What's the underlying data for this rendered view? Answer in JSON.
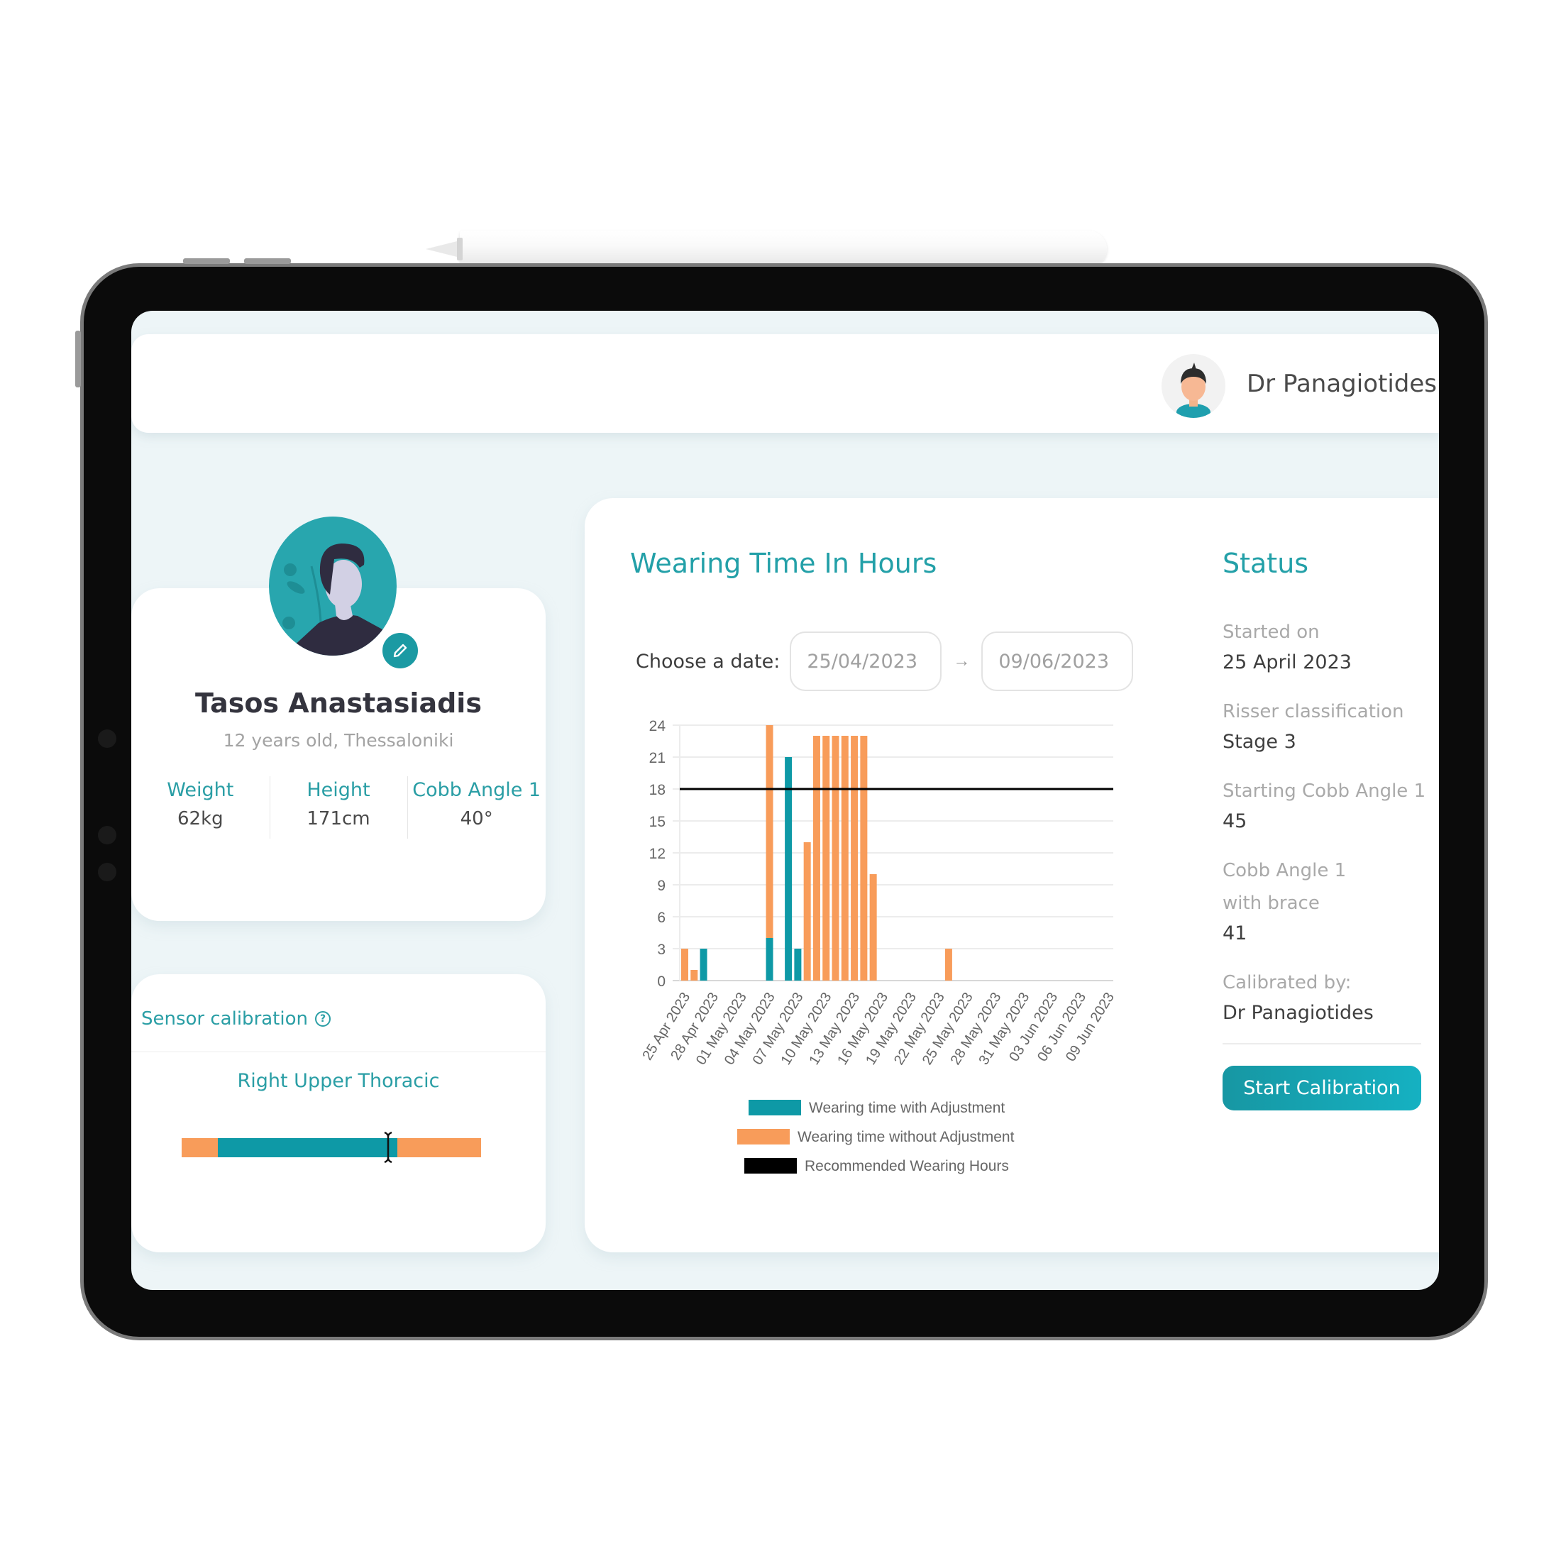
{
  "header": {
    "user_name": "Dr Panagiotides",
    "avatar_icon": "doctor-avatar-icon"
  },
  "profile": {
    "name": "Tasos Anastasiadis",
    "subtitle": "12 years old, Thessaloniki",
    "metrics": [
      {
        "label": "Weight",
        "value": "62kg"
      },
      {
        "label": "Height",
        "value": "171cm"
      },
      {
        "label": "Cobb Angle 1",
        "value": "40°"
      }
    ],
    "edit_icon": "pencil-icon"
  },
  "sensor": {
    "title": "Sensor calibration",
    "help_icon": "?",
    "region": "Right Upper Thoracic",
    "range_fraction": [
      0.12,
      0.72
    ],
    "cursor_fraction": 0.69,
    "colors": {
      "range": "#0e99a6",
      "outside": "#f89c5a"
    }
  },
  "wearing": {
    "title": "Wearing Time In Hours",
    "date_label": "Choose a date:",
    "date_from": "25/04/2023",
    "date_to": "09/06/2023",
    "arrow": "→"
  },
  "status": {
    "title": "Status",
    "items": [
      {
        "label": "Started on",
        "value": "25 April 2023"
      },
      {
        "label": "Risser classification",
        "value": "Stage 3"
      },
      {
        "label": "Starting Cobb Angle 1",
        "value": "45"
      },
      {
        "label": "Cobb Angle 1 with brace",
        "value": "41"
      },
      {
        "label": "Calibrated by:",
        "value": "Dr Panagiotides"
      }
    ],
    "button_label": "Start Calibration"
  },
  "chart_data": {
    "type": "bar",
    "stacked": true,
    "title": "Wearing Time In Hours",
    "xlabel": "",
    "ylabel": "",
    "ylim": [
      0,
      24
    ],
    "yticks": [
      0,
      3,
      6,
      9,
      12,
      15,
      18,
      21,
      24
    ],
    "grid": true,
    "legend_position": "bottom",
    "start_date": "2023-04-25",
    "num_days": 46,
    "tick_labels": [
      "25 Apr 2023",
      "28 Apr 2023",
      "01 May 2023",
      "04 May 2023",
      "07 May 2023",
      "10 May 2023",
      "13 May 2023",
      "16 May 2023",
      "19 May 2023",
      "22 May 2023",
      "25 May 2023",
      "28 May 2023",
      "31 May 2023",
      "03 Jun 2023",
      "06 Jun 2023",
      "09 Jun 2023"
    ],
    "tick_every_days": 3,
    "series": [
      {
        "name": "Wearing time with Adjustment",
        "color": "#0e99a6",
        "points": [
          {
            "date": "27 Apr 2023",
            "value": 3
          },
          {
            "date": "04 May 2023",
            "value": 4
          },
          {
            "date": "06 May 2023",
            "value": 21
          },
          {
            "date": "07 May 2023",
            "value": 3
          }
        ]
      },
      {
        "name": "Wearing time without Adjustment",
        "color": "#f89c5a",
        "points": [
          {
            "date": "25 Apr 2023",
            "value": 3
          },
          {
            "date": "26 Apr 2023",
            "value": 1
          },
          {
            "date": "04 May 2023",
            "value": 20
          },
          {
            "date": "08 May 2023",
            "value": 13
          },
          {
            "date": "09 May 2023",
            "value": 23
          },
          {
            "date": "10 May 2023",
            "value": 23
          },
          {
            "date": "11 May 2023",
            "value": 23
          },
          {
            "date": "12 May 2023",
            "value": 23
          },
          {
            "date": "13 May 2023",
            "value": 23
          },
          {
            "date": "14 May 2023",
            "value": 23
          },
          {
            "date": "15 May 2023",
            "value": 10
          },
          {
            "date": "23 May 2023",
            "value": 3
          }
        ]
      }
    ],
    "reference_line": {
      "name": "Recommended Wearing Hours",
      "value": 18,
      "color": "#000000"
    }
  }
}
